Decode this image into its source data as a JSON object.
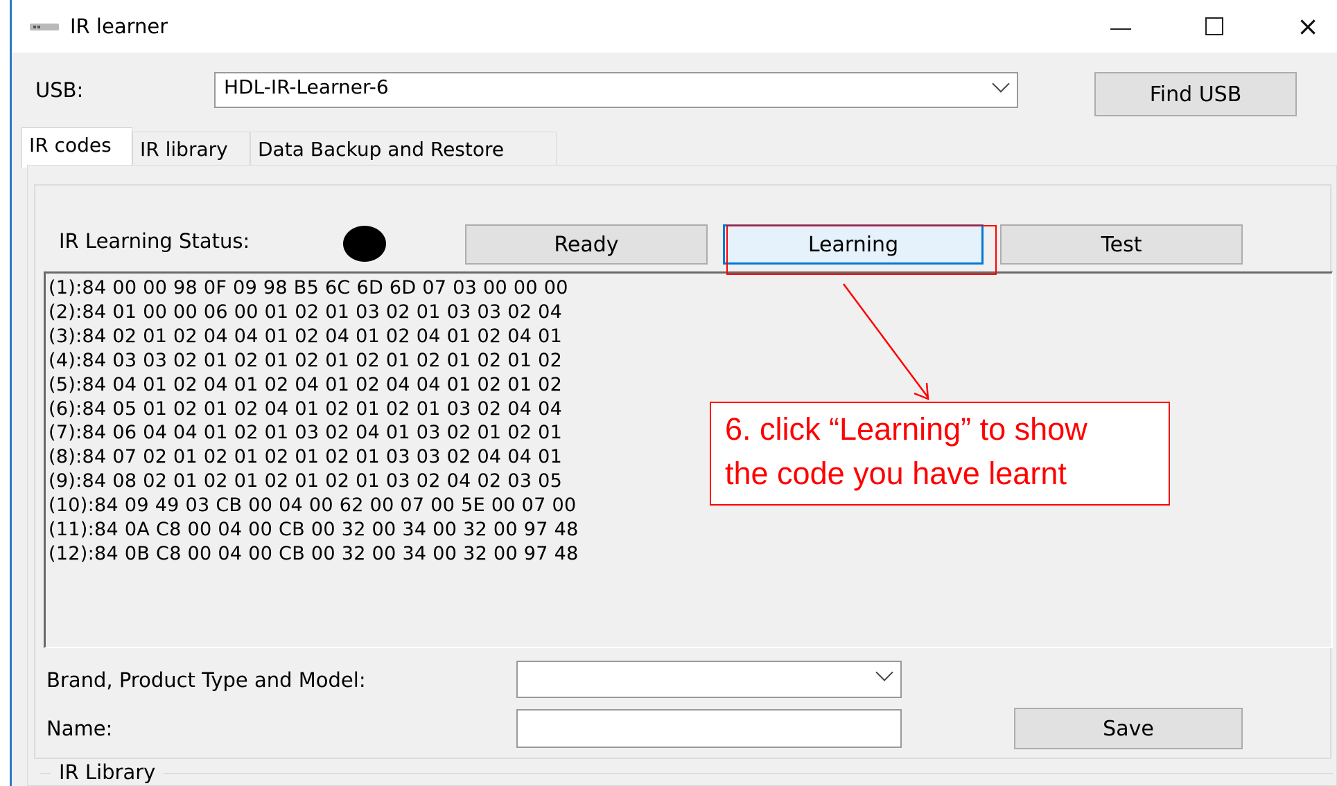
{
  "window": {
    "title": "IR learner",
    "icon": "usb-device-icon",
    "controls": {
      "minimize": "minimize-icon",
      "maximize": "maximize-icon",
      "close": "×"
    }
  },
  "usb": {
    "label": "USB:",
    "selected": "HDL-IR-Learner-6",
    "find_button": "Find USB"
  },
  "tabs": [
    {
      "label": "IR codes",
      "active": true
    },
    {
      "label": "IR library",
      "active": false
    },
    {
      "label": "Data Backup and Restore",
      "active": false
    }
  ],
  "learning": {
    "status_label": "IR Learning Status:",
    "status_color": "#000000",
    "buttons": {
      "ready": "Ready",
      "learning": "Learning",
      "test": "Test"
    }
  },
  "codes": [
    "(1):84 00 00 98 0F 09 98 B5 6C 6D 6D 07 03 00 00 00",
    "(2):84 01 00 00 06 00 01 02 01 03 02 01 03 03 02 04",
    "(3):84 02 01 02 04 04 01 02 04 01 02 04 01 02 04 01",
    "(4):84 03 03 02 01 02 01 02 01 02 01 02 01 02 01 02",
    "(5):84 04 01 02 04 01 02 04 01 02 04 04 01 02 01 02",
    "(6):84 05 01 02 01 02 04 01 02 01 02 01 03 02 04 04",
    "(7):84 06 04 04 01 02 01 03 02 04 01 03 02 01 02 01",
    "(8):84 07 02 01 02 01 02 01 02 01 03 03 02 04 04 01",
    "(9):84 08 02 01 02 01 02 01 02 01 03 02 04 02 03 05",
    "(10):84 09 49 03 CB 00 04 00 62 00 07 00 5E 00 07 00",
    "(11):84 0A C8 00 04 00 CB 00 32 00 34 00 32 00 97 48",
    "(12):84 0B C8 00 04 00 CB 00 32 00 34 00 32 00 97 48"
  ],
  "form": {
    "brand_label": "Brand, Product Type and Model:",
    "brand_value": "",
    "name_label": "Name:",
    "name_value": "",
    "save_button": "Save"
  },
  "library": {
    "legend": "IR Library"
  },
  "annotation": {
    "line1": "6. click “Learning” to show",
    "line2": "the code you have learnt",
    "color": "#ff0000"
  }
}
